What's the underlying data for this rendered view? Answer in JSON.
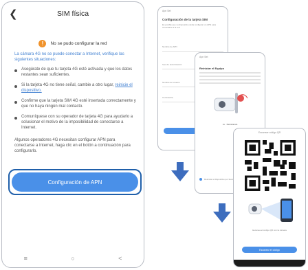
{
  "main": {
    "title": "SIM física",
    "warning": "No se pudo configurar la red",
    "intro": "La cámara 4G no se puede conectar a Internet, verifique las siguientes situaciones:",
    "items": [
      {
        "text": "Asegúrate de que tu tarjeta 4G esté activada y que los datos restantes sean suficientes.",
        "link": ""
      },
      {
        "text": "Si la tarjeta 4G no tiene señal, cambie a otro lugar, ",
        "link": "reinicie el dispositivo."
      },
      {
        "text": "Confirme que la tarjeta SIM 4G esté insertada correctamente y que no haya ningún mal contacto.",
        "link": ""
      },
      {
        "text": "Comuníquese con su operador de tarjeta 4G para ayudarlo a solucionar el motivo de la imposibilidad de conectarse a Internet.",
        "link": ""
      }
    ],
    "note": "Algunos operadores 4G necesitan configurar APN para conectarse a Internet, haga clic en el botón a continuación para configurarlo.",
    "apn_button": "Configuración de APN",
    "nav": [
      "≡",
      "○",
      "<"
    ]
  },
  "phone1": {
    "header": "Apn Set",
    "title": "Configuración de la tarjeta SIM",
    "subtitle": "Es posible que su dispositivo deba configurar un APN para conectarse a la red",
    "fields": [
      "Nombre de APN",
      "Tipo de autenticación",
      "Nombre de usuario",
      "Contraseña"
    ]
  },
  "phone2": {
    "header": "Apn Set",
    "title": "Reiniciar el Equipo",
    "caption": "1s · Reiniciando",
    "checkbox": "Reiniciar el dispositivo por favor"
  },
  "phone3": {
    "header": "Escanear código QR",
    "caption": "Escanea el código QR con la cámara",
    "button": "Escanear el código"
  },
  "colors": {
    "accent": "#4a90e8",
    "link": "#3f7fd1",
    "warning": "#f0922b",
    "highlight": "#1f5faa",
    "arrow": "#3d6dbe"
  }
}
